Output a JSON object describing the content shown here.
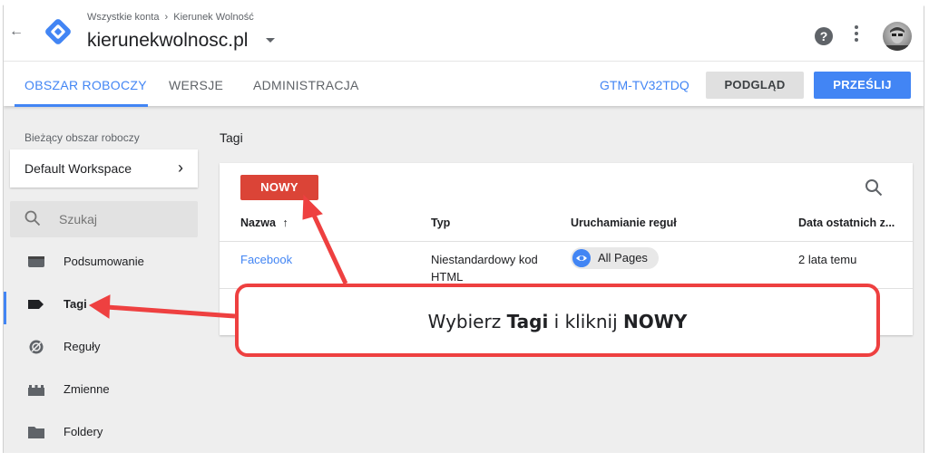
{
  "header": {
    "breadcrumb": [
      "Wszystkie konta",
      "Kierunek Wolność"
    ],
    "breadcrumb_separator": "›",
    "container_name": "kierunekwolnosc.pl",
    "back_icon": "arrow-back-icon",
    "help_icon": "help-icon",
    "more_icon": "more-vert-icon"
  },
  "tabs": {
    "items": [
      {
        "label": "OBSZAR ROBOCZY",
        "active": true
      },
      {
        "label": "WERSJE",
        "active": false
      },
      {
        "label": "ADMINISTRACJA",
        "active": false
      }
    ],
    "container_id": "GTM-TV32TDQ",
    "preview_label": "PODGLĄD",
    "submit_label": "PRZEŚLIJ"
  },
  "sidebar": {
    "workspace_label": "Bieżący obszar roboczy",
    "workspace_name": "Default Workspace",
    "search_placeholder": "Szukaj",
    "items": [
      {
        "label": "Podsumowanie",
        "icon": "overview-icon",
        "active": false
      },
      {
        "label": "Tagi",
        "icon": "tag-icon",
        "active": true
      },
      {
        "label": "Reguły",
        "icon": "trigger-icon",
        "active": false
      },
      {
        "label": "Zmienne",
        "icon": "variables-icon",
        "active": false
      },
      {
        "label": "Foldery",
        "icon": "folder-icon",
        "active": false
      }
    ]
  },
  "main": {
    "title": "Tagi",
    "new_button": "NOWY",
    "columns": [
      "Nazwa",
      "Typ",
      "Uruchamianie reguł",
      "Data ostatnich z..."
    ],
    "sort_indicator": "↑",
    "rows": [
      {
        "name": "Facebook",
        "type_line1": "Niestandardowy kod",
        "type_line2": "HTML",
        "trigger": "All Pages",
        "modified": "2 lata temu"
      }
    ]
  },
  "callout": {
    "text_before": "Wybierz ",
    "bold1": "Tagi",
    "text_middle": " i kliknij ",
    "bold2": "NOWY"
  },
  "colors": {
    "accent": "#4285f4",
    "new_button": "#db4437",
    "callout_border": "#ee4040"
  }
}
